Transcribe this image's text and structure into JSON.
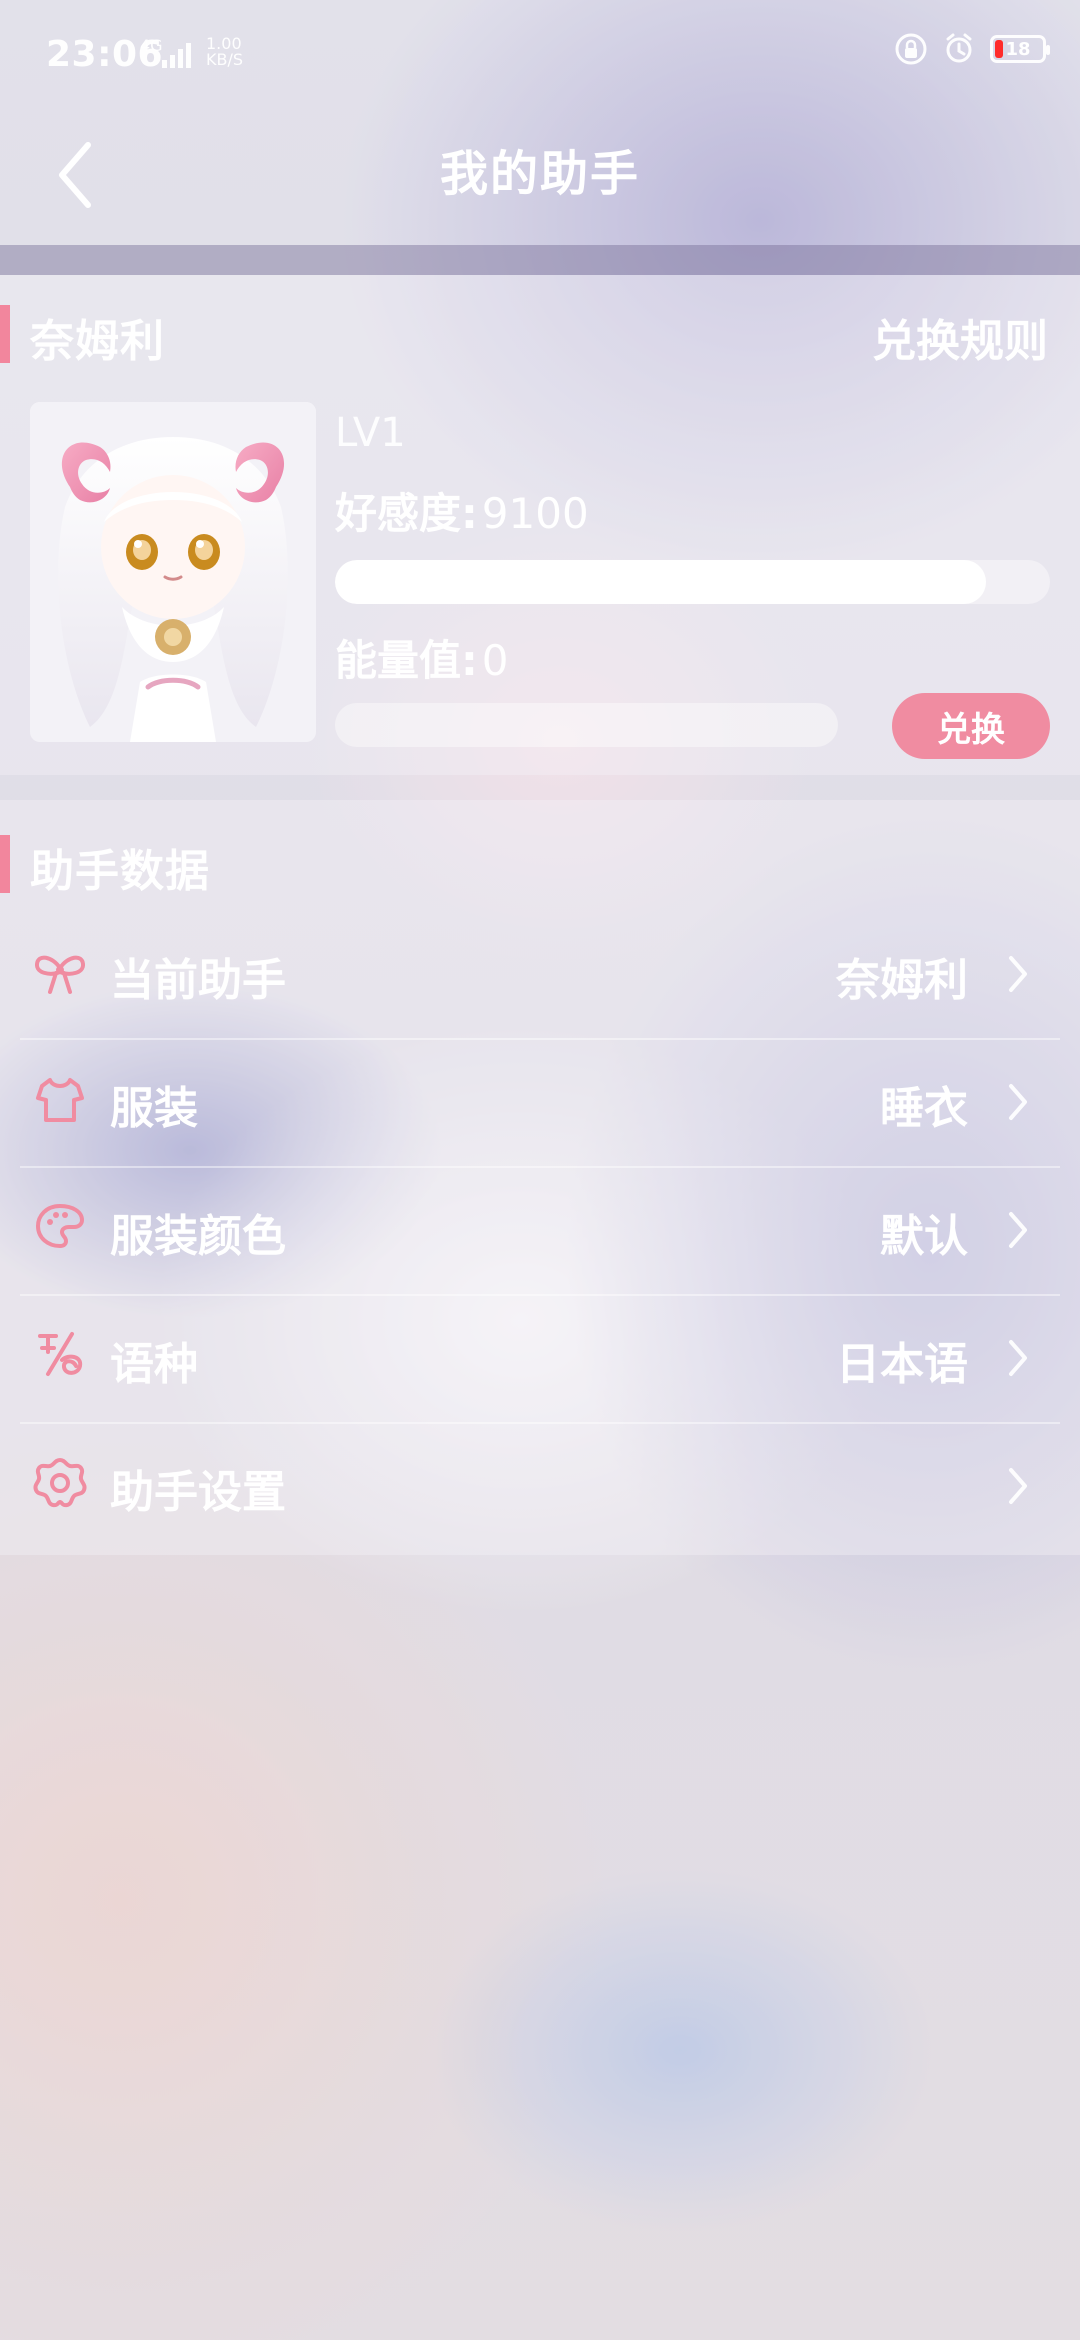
{
  "status_bar": {
    "time": "23:06",
    "network": "4G",
    "speed_value": "1.00",
    "speed_unit": "KB/S",
    "battery": "18",
    "battery_color": "#ff2b2b"
  },
  "header": {
    "title": "我的助手",
    "back_icon": "chevron-left-icon"
  },
  "assistant_card": {
    "name": "奈姆利",
    "rules_link": "兑换规则",
    "level": "LV1",
    "favor_label": "好感度:",
    "favor_value": "9100",
    "favor_progress": 0.91,
    "energy_label": "能量值:",
    "energy_value": "0",
    "energy_progress": 0.0,
    "exchange_button": "兑换",
    "accent_color": "#f2869d",
    "button_color": "#f08ca1"
  },
  "data_section": {
    "title": "助手数据",
    "items": [
      {
        "icon": "bow-icon",
        "label": "当前助手",
        "value": "奈姆利"
      },
      {
        "icon": "shirt-icon",
        "label": "服装",
        "value": "睡衣"
      },
      {
        "icon": "palette-icon",
        "label": "服装颜色",
        "value": "默认"
      },
      {
        "icon": "language-icon",
        "label": "语种",
        "value": "日本语"
      },
      {
        "icon": "gear-icon",
        "label": "助手设置",
        "value": ""
      }
    ]
  }
}
